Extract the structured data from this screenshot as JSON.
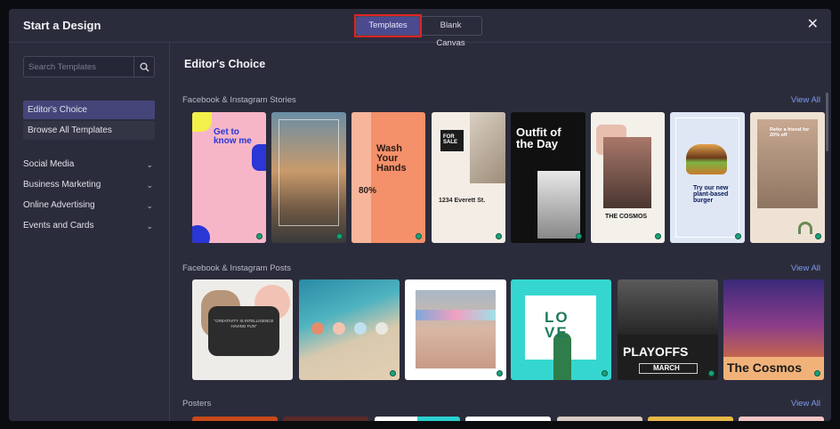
{
  "header": {
    "title": "Start a Design",
    "tabs": [
      {
        "label": "Templates",
        "active": true
      },
      {
        "label": "Blank Canvas",
        "active": false
      }
    ],
    "close_glyph": "✕"
  },
  "sidebar": {
    "search_placeholder": "Search Templates",
    "items": [
      {
        "label": "Editor's Choice",
        "selected": true
      },
      {
        "label": "Browse All Templates",
        "selected": false
      }
    ],
    "categories": [
      {
        "label": "Social Media"
      },
      {
        "label": "Business Marketing"
      },
      {
        "label": "Online Advertising"
      },
      {
        "label": "Events and Cards"
      }
    ]
  },
  "main": {
    "title": "Editor's Choice",
    "sections": [
      {
        "label": "Facebook & Instagram Stories",
        "view_all": "View All"
      },
      {
        "label": "Facebook & Instagram Posts",
        "view_all": "View All"
      },
      {
        "label": "Posters",
        "view_all": "View All"
      }
    ],
    "stories": [
      {
        "text": "Get to know me"
      },
      {
        "text": ""
      },
      {
        "text": "Wash Your Hands",
        "sub": "80%"
      },
      {
        "text": "FOR SALE",
        "sub": "1234 Everett St."
      },
      {
        "text": "Outfit of the Day"
      },
      {
        "text": "THE COSMOS"
      },
      {
        "text": "Try our new plant-based burger"
      },
      {
        "text": "Refer a friend for 20% off"
      }
    ],
    "posts": [
      {
        "text": "\"CREATIVITY IS INTELLIGENCE HAVING FUN\""
      },
      {
        "text": ""
      },
      {
        "text": ""
      },
      {
        "text": "LO VE"
      },
      {
        "text": "PLAYOFFS",
        "sub": "MARCH"
      },
      {
        "text": "The Cosmos"
      }
    ]
  },
  "colors": {
    "accent": "#4b4a8f",
    "highlight": "#e02424",
    "link": "#7a9af0",
    "status_dot": "#1aa37a"
  }
}
